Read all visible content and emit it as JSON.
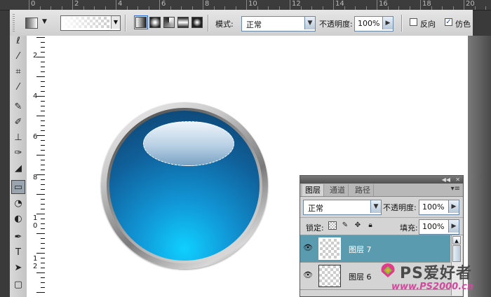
{
  "rulers": {
    "top_numbers": [
      "0",
      "2",
      "4",
      "6",
      "8",
      "10",
      "12",
      "14",
      "16",
      "18",
      "20"
    ],
    "left_numbers": [
      "2",
      "4",
      "6",
      "8",
      "1\n0",
      "1\n2"
    ]
  },
  "options_bar": {
    "mode_label": "模式:",
    "mode_value": "正常",
    "opacity_label": "不透明度:",
    "opacity_value": "100%",
    "reverse_label": "反向",
    "reverse_checked": false,
    "dither_label": "仿色",
    "dither_checked": true,
    "gradient_types": [
      "linear",
      "radial",
      "angle",
      "reflected",
      "diamond"
    ],
    "selected_gradient_type": "linear"
  },
  "tools": {
    "icons": [
      "lasso-icon",
      "magic-wand-icon",
      "crop-icon",
      "eyedropper-icon",
      "healing-brush-icon",
      "brush-icon",
      "clone-stamp-icon",
      "history-brush-icon",
      "eraser-icon",
      "gradient-icon",
      "blur-icon",
      "dodge-icon",
      "pen-icon",
      "type-icon",
      "path-select-icon",
      "shape-icon"
    ],
    "selected": "gradient-icon"
  },
  "layers_panel": {
    "tabs": [
      "图层",
      "通道",
      "路径"
    ],
    "active_tab": "图层",
    "blend_mode": "正常",
    "opacity_label": "不透明度:",
    "opacity_value": "100%",
    "lock_label": "锁定:",
    "fill_label": "填充:",
    "fill_value": "100%",
    "layers": [
      {
        "name": "图层 7",
        "selected": true,
        "visible": true
      },
      {
        "name": "图层 6",
        "selected": false,
        "visible": true
      }
    ]
  },
  "watermark": {
    "brand": "PS爱好者",
    "url": "www.PS2000.cn"
  },
  "colors": {
    "selection_highlight": "#5b9bb0",
    "orb_blue": "#1196d6",
    "watermark_pink": "#d24a9e"
  }
}
